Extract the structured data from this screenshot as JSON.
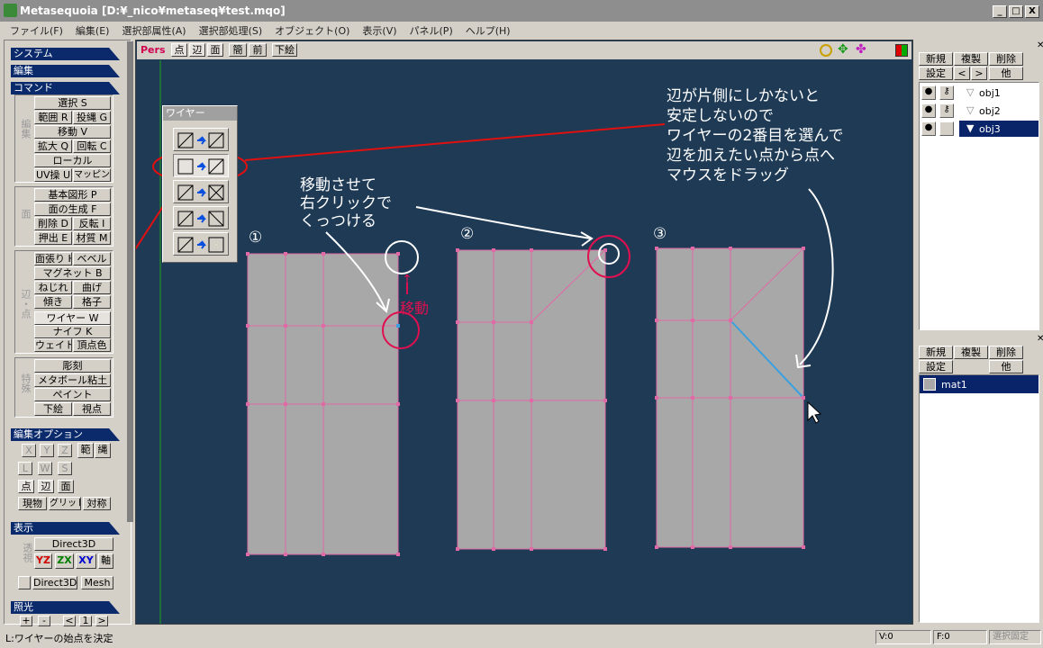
{
  "window": {
    "title": "Metasequoia [D:¥_nico¥metaseq¥test.mqo]",
    "min": "_",
    "max": "□",
    "close": "X"
  },
  "menu": [
    "ファイル(F)",
    "編集(E)",
    "選択部属性(A)",
    "選択部処理(S)",
    "オブジェクト(O)",
    "表示(V)",
    "パネル(P)",
    "ヘルプ(H)"
  ],
  "left": {
    "heads": {
      "system": "システム",
      "edit": "編集",
      "command": "コマンド",
      "editopt": "編集オプション",
      "display": "表示",
      "light": "照光"
    },
    "tags": {
      "edit": "編集",
      "face": "面",
      "edge": "辺・点",
      "special": "特殊",
      "transp": "透視"
    },
    "cmd_edit": [
      "選択 S",
      "範囲 R",
      "投縄 G",
      "移動 V",
      "拡大 Q",
      "回転 C",
      "ローカル",
      "UV操 U",
      "マッピング"
    ],
    "cmd_face": [
      "基本図形 P",
      "面の生成 F",
      "削除 D",
      "反転 I",
      "押出 E",
      "材質 M"
    ],
    "cmd_edge": [
      "面張り H",
      "ベベル",
      "マグネット B",
      "ねじれ",
      "曲げ",
      "傾き",
      "格子",
      "ワイヤー W",
      "ナイフ K",
      "ウェイト",
      "頂点色"
    ],
    "cmd_special": [
      "彫刻",
      "メタボール粘土",
      "ペイント",
      "下絵",
      "視点"
    ],
    "editopt": [
      "X",
      "Y",
      "Z",
      "範",
      "縄",
      "L",
      "W",
      "S",
      "点",
      "辺",
      "面",
      "現物",
      "グリッド",
      "対称"
    ],
    "display": {
      "d3d": "Direct3D",
      "yz": "YZ",
      "zx": "ZX",
      "xy": "XY",
      "axis": "軸",
      "d3d2": "Direct3D",
      "mesh": "Mesh"
    },
    "light": [
      "+",
      "-",
      "<",
      "1",
      ">"
    ]
  },
  "viewport": {
    "toolbar": [
      "Pers",
      "点",
      "辺",
      "面",
      "簡",
      "前",
      "下絵"
    ],
    "wire_panel_title": "ワイヤー",
    "notes": {
      "a": [
        "辺が片側にしかないと",
        "安定しないので",
        "ワイヤーの2番目を選んで",
        "辺を加えたい点から点へ",
        "マウスをドラッグ"
      ],
      "b": [
        "移動させて",
        "右クリックで",
        "くっつける"
      ],
      "move": "↑",
      "move2": "移動"
    },
    "labels": [
      "①",
      "②",
      "③"
    ]
  },
  "right": {
    "obj_buttons": [
      "新規",
      "複製",
      "削除",
      "設定",
      "<",
      ">",
      "他"
    ],
    "objects": [
      {
        "name": "obj1",
        "sel": false
      },
      {
        "name": "obj2",
        "sel": false
      },
      {
        "name": "obj3",
        "sel": true
      }
    ],
    "mat_buttons": [
      "新規",
      "複製",
      "削除",
      "設定",
      "他"
    ],
    "materials": [
      {
        "name": "mat1",
        "sel": true
      }
    ]
  },
  "status": {
    "text": "L:ワイヤーの始点を決定",
    "v": "V:0",
    "f": "F:0",
    "fix": "選択固定"
  },
  "colors": {
    "viewport": "#1e3a55",
    "mesh": "#a9a8a8",
    "edge": "#e06aa6",
    "highlight": "#e01050",
    "blue": "#3aa0e0",
    "accent": "#0a246a"
  }
}
